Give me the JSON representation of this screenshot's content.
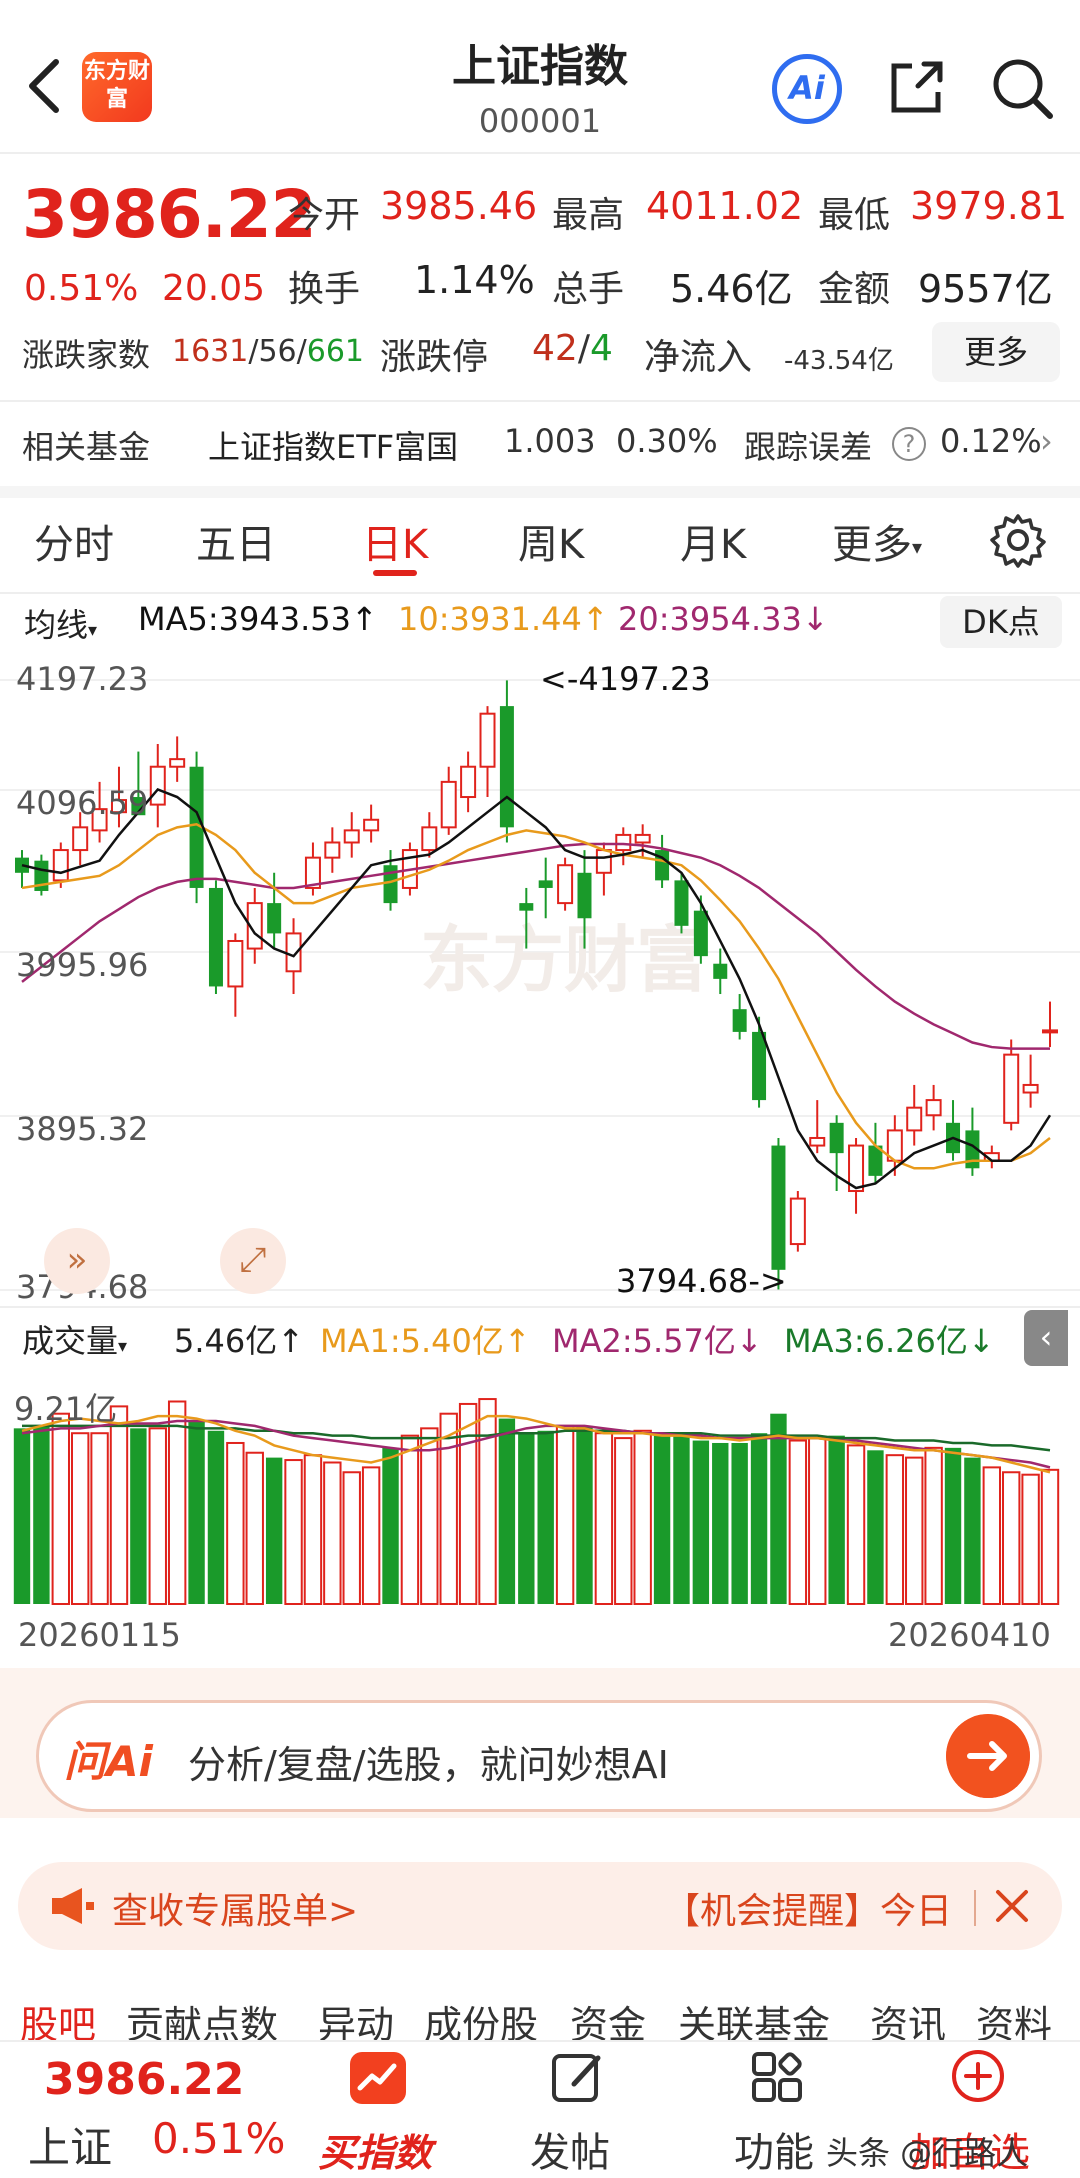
{
  "header": {
    "brand_logo_text": "东方财富",
    "title": "上证指数",
    "code": "000001",
    "ai_label": "Ai"
  },
  "quote": {
    "price": "3986.22",
    "change_pct": "0.51%",
    "change_amt": "20.05",
    "open_label": "今开",
    "open": "3985.46",
    "high_label": "最高",
    "high": "4011.02",
    "low_label": "最低",
    "low": "3979.81",
    "turnover_label": "换手",
    "turnover": "1.14%",
    "volume_label": "总手",
    "volume": "5.46亿",
    "amount_label": "金额",
    "amount": "9557亿",
    "breadth_label": "涨跌家数",
    "breadth_up": "1631",
    "breadth_flat": "/56/",
    "breadth_down": "661",
    "limit_label": "涨跌停",
    "limit_up": "42",
    "limit_sep": "/",
    "limit_down": "4",
    "netflow_label": "净流入",
    "netflow": "-43.54亿",
    "more_label": "更多"
  },
  "fund": {
    "label": "相关基金",
    "name": "上证指数ETF富国",
    "price": "1.003",
    "pct": "0.30%",
    "tracking_label": "跟踪误差",
    "tracking": "0.12%"
  },
  "tabs": {
    "items": [
      "分时",
      "五日",
      "日K",
      "周K",
      "月K",
      "更多"
    ],
    "active": "日K"
  },
  "ma": {
    "selector": "均线",
    "ma5": "MA5:3943.53↑",
    "ma10": "10:3931.44↑",
    "ma20": "20:3954.33↓",
    "dk_label": "DK点"
  },
  "kline_axis": {
    "y1": "4197.23",
    "y2": "4096.59",
    "y3": "3995.96",
    "y4": "3895.32",
    "y5": "3794.68",
    "high_marker": "<-4197.23",
    "low_marker": "3794.68->"
  },
  "volume_legend": {
    "selector": "成交量",
    "vol": "5.46亿↑",
    "ma1": "MA1:5.40亿↑",
    "ma2": "MA2:5.57亿↓",
    "ma3": "MA3:6.26亿↓",
    "axis_top": "9.21亿"
  },
  "dates": {
    "start": "20260115",
    "end": "20260410"
  },
  "ai_bar": {
    "logo": "问Ai",
    "text": "分析/复盘/选股，就问妙想AI"
  },
  "notice": {
    "left": "查收专属股单>",
    "right": "【机会提醒】今日"
  },
  "sub_tabs": [
    "股吧",
    "贡献点数",
    "异动",
    "成份股",
    "资金",
    "关联基金",
    "资讯",
    "资料"
  ],
  "bottom": {
    "price": "3986.22",
    "name": "上证",
    "pct": "0.51%",
    "buy": "买指数",
    "post": "发帖",
    "func": "功能",
    "add": "加自选",
    "watermark": "头条 @行路人"
  },
  "colors": {
    "up": "#e0231c",
    "down": "#1a9a2a",
    "ma5": "#111111",
    "ma10": "#e89a1c",
    "ma20": "#a0286e"
  },
  "chart_data": {
    "type": "candlestick",
    "candles": [
      {
        "o": 4070,
        "h": 4085,
        "l": 4060,
        "c": 4080,
        "up": false
      },
      {
        "o": 4078,
        "h": 4082,
        "l": 4055,
        "c": 4058,
        "up": false
      },
      {
        "o": 4065,
        "h": 4090,
        "l": 4060,
        "c": 4085,
        "up": true
      },
      {
        "o": 4085,
        "h": 4110,
        "l": 4075,
        "c": 4100,
        "up": true
      },
      {
        "o": 4098,
        "h": 4130,
        "l": 4090,
        "c": 4112,
        "up": true
      },
      {
        "o": 4110,
        "h": 4140,
        "l": 4100,
        "c": 4118,
        "up": true
      },
      {
        "o": 4120,
        "h": 4150,
        "l": 4110,
        "c": 4108,
        "up": false
      },
      {
        "o": 4115,
        "h": 4155,
        "l": 4100,
        "c": 4140,
        "up": true
      },
      {
        "o": 4140,
        "h": 4160,
        "l": 4130,
        "c": 4145,
        "up": true
      },
      {
        "o": 4140,
        "h": 4150,
        "l": 4050,
        "c": 4060,
        "up": false
      },
      {
        "o": 4060,
        "h": 4065,
        "l": 3990,
        "c": 3995,
        "up": false
      },
      {
        "o": 3995,
        "h": 4030,
        "l": 3975,
        "c": 4025,
        "up": true
      },
      {
        "o": 4020,
        "h": 4060,
        "l": 4010,
        "c": 4050,
        "up": true
      },
      {
        "o": 4050,
        "h": 4070,
        "l": 4020,
        "c": 4030,
        "up": false
      },
      {
        "o": 4030,
        "h": 4040,
        "l": 3990,
        "c": 4005,
        "up": true
      },
      {
        "o": 4060,
        "h": 4090,
        "l": 4055,
        "c": 4080,
        "up": true
      },
      {
        "o": 4080,
        "h": 4100,
        "l": 4070,
        "c": 4090,
        "up": true
      },
      {
        "o": 4090,
        "h": 4110,
        "l": 4080,
        "c": 4098,
        "up": true
      },
      {
        "o": 4098,
        "h": 4115,
        "l": 4090,
        "c": 4105,
        "up": true
      },
      {
        "o": 4075,
        "h": 4085,
        "l": 4045,
        "c": 4050,
        "up": false
      },
      {
        "o": 4060,
        "h": 4090,
        "l": 4055,
        "c": 4085,
        "up": true
      },
      {
        "o": 4085,
        "h": 4110,
        "l": 4080,
        "c": 4100,
        "up": true
      },
      {
        "o": 4100,
        "h": 4140,
        "l": 4095,
        "c": 4130,
        "up": true
      },
      {
        "o": 4120,
        "h": 4150,
        "l": 4110,
        "c": 4140,
        "up": true
      },
      {
        "o": 4140,
        "h": 4180,
        "l": 4120,
        "c": 4175,
        "up": true
      },
      {
        "o": 4180,
        "h": 4197,
        "l": 4090,
        "c": 4100,
        "up": false
      },
      {
        "o": 4050,
        "h": 4060,
        "l": 4020,
        "c": 4045,
        "up": false
      },
      {
        "o": 4060,
        "h": 4080,
        "l": 4040,
        "c": 4065,
        "up": false
      },
      {
        "o": 4050,
        "h": 4080,
        "l": 4045,
        "c": 4075,
        "up": true
      },
      {
        "o": 4070,
        "h": 4085,
        "l": 4020,
        "c": 4040,
        "up": false
      },
      {
        "o": 4070,
        "h": 4090,
        "l": 4055,
        "c": 4085,
        "up": true
      },
      {
        "o": 4085,
        "h": 4100,
        "l": 4075,
        "c": 4095,
        "up": true
      },
      {
        "o": 4095,
        "h": 4102,
        "l": 4080,
        "c": 4090,
        "up": true
      },
      {
        "o": 4085,
        "h": 4095,
        "l": 4060,
        "c": 4065,
        "up": false
      },
      {
        "o": 4065,
        "h": 4070,
        "l": 4030,
        "c": 4035,
        "up": false
      },
      {
        "o": 4045,
        "h": 4055,
        "l": 4010,
        "c": 4015,
        "up": false
      },
      {
        "o": 4010,
        "h": 4020,
        "l": 3990,
        "c": 4000,
        "up": false
      },
      {
        "o": 3980,
        "h": 3990,
        "l": 3960,
        "c": 3965,
        "up": false
      },
      {
        "o": 3965,
        "h": 3975,
        "l": 3915,
        "c": 3920,
        "up": false
      },
      {
        "o": 3890,
        "h": 3895,
        "l": 3795,
        "c": 3808,
        "up": false
      },
      {
        "o": 3825,
        "h": 3860,
        "l": 3820,
        "c": 3855,
        "up": true
      },
      {
        "o": 3890,
        "h": 3920,
        "l": 3885,
        "c": 3895,
        "up": true
      },
      {
        "o": 3905,
        "h": 3910,
        "l": 3860,
        "c": 3885,
        "up": false
      },
      {
        "o": 3860,
        "h": 3895,
        "l": 3845,
        "c": 3890,
        "up": true
      },
      {
        "o": 3890,
        "h": 3905,
        "l": 3865,
        "c": 3870,
        "up": false
      },
      {
        "o": 3880,
        "h": 3910,
        "l": 3870,
        "c": 3900,
        "up": true
      },
      {
        "o": 3900,
        "h": 3930,
        "l": 3890,
        "c": 3915,
        "up": true
      },
      {
        "o": 3920,
        "h": 3930,
        "l": 3900,
        "c": 3910,
        "up": true
      },
      {
        "o": 3905,
        "h": 3920,
        "l": 3880,
        "c": 3885,
        "up": false
      },
      {
        "o": 3900,
        "h": 3915,
        "l": 3870,
        "c": 3875,
        "up": false
      },
      {
        "o": 3885,
        "h": 3890,
        "l": 3875,
        "c": 3880,
        "up": true
      },
      {
        "o": 3905,
        "h": 3960,
        "l": 3900,
        "c": 3950,
        "up": true
      },
      {
        "o": 3930,
        "h": 3950,
        "l": 3915,
        "c": 3925,
        "up": true
      },
      {
        "o": 3965,
        "h": 3985,
        "l": 3955,
        "c": 3966,
        "up": true
      }
    ],
    "ma5": [
      4075,
      4072,
      4070,
      4074,
      4078,
      4095,
      4110,
      4125,
      4120,
      4110,
      4080,
      4050,
      4030,
      4020,
      4015,
      4030,
      4045,
      4060,
      4075,
      4078,
      4080,
      4082,
      4090,
      4100,
      4110,
      4120,
      4110,
      4100,
      4085,
      4080,
      4080,
      4082,
      4085,
      4080,
      4070,
      4050,
      4025,
      4000,
      3970,
      3935,
      3900,
      3880,
      3870,
      3862,
      3865,
      3875,
      3885,
      3890,
      3895,
      3890,
      3880,
      3880,
      3890,
      3910
    ],
    "ma10": [
      4060,
      4062,
      4064,
      4066,
      4068,
      4075,
      4085,
      4095,
      4100,
      4102,
      4095,
      4085,
      4070,
      4060,
      4050,
      4050,
      4055,
      4060,
      4062,
      4064,
      4068,
      4072,
      4078,
      4085,
      4090,
      4095,
      4098,
      4096,
      4094,
      4090,
      4085,
      4082,
      4080,
      4078,
      4075,
      4065,
      4052,
      4038,
      4020,
      4000,
      3975,
      3950,
      3925,
      3905,
      3890,
      3880,
      3875,
      3875,
      3878,
      3880,
      3880,
      3880,
      3885,
      3895
    ],
    "ma20": [
      3998,
      4008,
      4018,
      4028,
      4038,
      4046,
      4054,
      4060,
      4064,
      4066,
      4066,
      4064,
      4062,
      4060,
      4060,
      4062,
      4064,
      4066,
      4068,
      4070,
      4072,
      4074,
      4076,
      4078,
      4080,
      4082,
      4084,
      4086,
      4088,
      4089,
      4089,
      4089,
      4088,
      4086,
      4083,
      4080,
      4075,
      4068,
      4060,
      4050,
      4040,
      4030,
      4018,
      4006,
      3995,
      3985,
      3977,
      3970,
      3964,
      3958,
      3955,
      3954,
      3954,
      3954
    ],
    "volume": [
      7.2,
      7.3,
      7.8,
      7.0,
      7.0,
      8.1,
      7.2,
      7.2,
      8.3,
      7.5,
      7.1,
      6.6,
      6.2,
      6.0,
      5.9,
      6.1,
      5.8,
      5.4,
      5.6,
      6.4,
      6.9,
      7.2,
      7.8,
      8.2,
      8.4,
      7.6,
      7.0,
      7.1,
      7.3,
      7.3,
      7.0,
      6.8,
      7.1,
      6.9,
      6.9,
      6.7,
      6.6,
      6.6,
      7.0,
      7.8,
      6.7,
      6.8,
      6.9,
      6.5,
      6.3,
      6.1,
      6.0,
      6.4,
      6.4,
      6.0,
      5.6,
      5.4,
      5.3,
      5.5
    ],
    "vol_ma1": [
      7.1,
      7.3,
      7.5,
      7.6,
      7.5,
      7.4,
      7.5,
      7.7,
      7.7,
      7.6,
      7.4,
      7.1,
      6.9,
      6.5,
      6.3,
      6.1,
      6.0,
      5.9,
      5.8,
      6.0,
      6.3,
      6.6,
      6.9,
      7.3,
      7.7,
      7.7,
      7.6,
      7.4,
      7.2,
      7.2,
      7.0,
      7.0,
      7.0,
      6.9,
      6.9,
      6.8,
      6.8,
      6.7,
      6.8,
      6.9,
      6.8,
      6.8,
      6.7,
      6.6,
      6.5,
      6.4,
      6.3,
      6.3,
      6.2,
      6.1,
      6.0,
      5.8,
      5.6,
      5.4
    ],
    "vol_ma2": [
      7.0,
      7.1,
      7.2,
      7.2,
      7.3,
      7.4,
      7.4,
      7.4,
      7.5,
      7.5,
      7.5,
      7.4,
      7.3,
      7.1,
      6.9,
      6.8,
      6.7,
      6.6,
      6.5,
      6.4,
      6.3,
      6.3,
      6.4,
      6.6,
      6.8,
      7.0,
      7.2,
      7.3,
      7.3,
      7.3,
      7.2,
      7.1,
      7.0,
      7.0,
      6.9,
      6.9,
      6.8,
      6.8,
      6.8,
      6.8,
      6.8,
      6.8,
      6.7,
      6.7,
      6.6,
      6.5,
      6.4,
      6.3,
      6.2,
      6.1,
      6.0,
      5.9,
      5.8,
      5.6
    ],
    "vol_ma3": [
      7.3,
      7.3,
      7.3,
      7.3,
      7.3,
      7.3,
      7.3,
      7.3,
      7.3,
      7.2,
      7.2,
      7.2,
      7.1,
      7.1,
      7.0,
      7.0,
      6.9,
      6.9,
      6.8,
      6.8,
      6.8,
      6.8,
      6.8,
      6.9,
      6.9,
      7.0,
      7.0,
      7.0,
      7.1,
      7.1,
      7.1,
      7.1,
      7.0,
      7.0,
      7.0,
      7.0,
      6.9,
      6.9,
      6.9,
      6.9,
      6.9,
      6.9,
      6.8,
      6.8,
      6.8,
      6.7,
      6.7,
      6.7,
      6.6,
      6.6,
      6.5,
      6.5,
      6.4,
      6.3
    ]
  }
}
